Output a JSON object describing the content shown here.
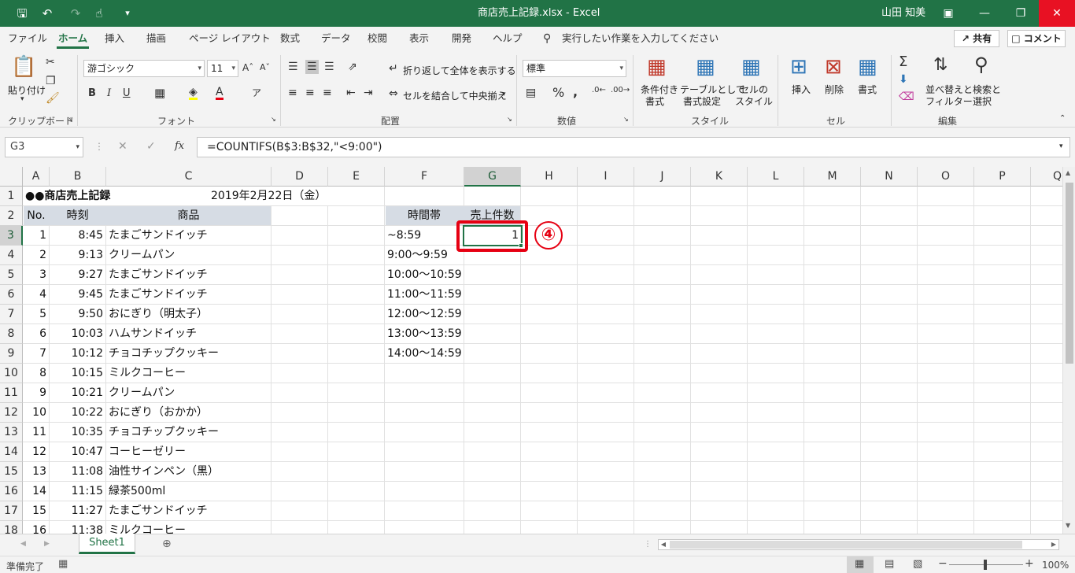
{
  "titlebar": {
    "filename": "商店売上記録.xlsx",
    "separator": " - ",
    "app": "Excel",
    "user": "山田 知美"
  },
  "menu_tabs": [
    "ファイル",
    "ホーム",
    "挿入",
    "描画",
    "ページ レイアウト",
    "数式",
    "データ",
    "校閲",
    "表示",
    "開発",
    "ヘルプ"
  ],
  "search_placeholder": "実行したい作業を入力してください",
  "share_label": "共有",
  "comment_label": "コメント",
  "ribbon": {
    "paste": "貼り付け",
    "clipboard_group": "クリップボード",
    "font_name": "游ゴシック",
    "font_size": "11",
    "font_group": "フォント",
    "wrap_text": "折り返して全体を表示する",
    "merge_center": "セルを結合して中央揃え",
    "alignment_group": "配置",
    "number_format": "標準",
    "number_group": "数値",
    "cond_format_1": "条件付き",
    "cond_format_2": "書式",
    "table_format_1": "テーブルとして",
    "table_format_2": "書式設定",
    "cell_style_1": "セルの",
    "cell_style_2": "スタイル",
    "styles_group": "スタイル",
    "insert": "挿入",
    "delete": "削除",
    "format": "書式",
    "cells_group": "セル",
    "sort_filter_1": "並べ替えと",
    "sort_filter_2": "フィルター",
    "find_select_1": "検索と",
    "find_select_2": "選択",
    "editing_group": "編集"
  },
  "formula_bar": {
    "name_box": "G3",
    "formula": "=COUNTIFS(B$3:B$32,\"<9:00\")"
  },
  "columns": [
    "A",
    "B",
    "C",
    "D",
    "E",
    "F",
    "G",
    "H",
    "I",
    "J",
    "K",
    "L",
    "M",
    "N",
    "O",
    "P",
    "Q"
  ],
  "row_numbers": [
    "1",
    "2",
    "3",
    "4",
    "5",
    "6",
    "7",
    "8",
    "9",
    "10",
    "11",
    "12",
    "13",
    "14",
    "15",
    "16",
    "17",
    "18"
  ],
  "sheet_title": "●●商店売上記録",
  "sheet_date": "2019年2月22日（金）",
  "table_headers": {
    "no": "No.",
    "time": "時刻",
    "item": "商品",
    "period": "時間帯",
    "count": "売上件数"
  },
  "records": [
    {
      "no": "1",
      "time": "8:45",
      "item": "たまごサンドイッチ"
    },
    {
      "no": "2",
      "time": "9:13",
      "item": "クリームパン"
    },
    {
      "no": "3",
      "time": "9:27",
      "item": "たまごサンドイッチ"
    },
    {
      "no": "4",
      "time": "9:45",
      "item": "たまごサンドイッチ"
    },
    {
      "no": "5",
      "time": "9:50",
      "item": "おにぎり（明太子）"
    },
    {
      "no": "6",
      "time": "10:03",
      "item": "ハムサンドイッチ"
    },
    {
      "no": "7",
      "time": "10:12",
      "item": "チョコチップクッキー"
    },
    {
      "no": "8",
      "time": "10:15",
      "item": "ミルクコーヒー"
    },
    {
      "no": "9",
      "time": "10:21",
      "item": "クリームパン"
    },
    {
      "no": "10",
      "time": "10:22",
      "item": "おにぎり（おかか）"
    },
    {
      "no": "11",
      "time": "10:35",
      "item": "チョコチップクッキー"
    },
    {
      "no": "12",
      "time": "10:47",
      "item": "コーヒーゼリー"
    },
    {
      "no": "13",
      "time": "11:08",
      "item": "油性サインペン（黒）"
    },
    {
      "no": "14",
      "time": "11:15",
      "item": "緑茶500ml"
    },
    {
      "no": "15",
      "time": "11:27",
      "item": "たまごサンドイッチ"
    },
    {
      "no": "16",
      "time": "11:38",
      "item": "ミルクコーヒー"
    }
  ],
  "periods": [
    "~8:59",
    "9:00～9:59",
    "10:00～10:59",
    "11:00～11:59",
    "12:00～12:59",
    "13:00～13:59",
    "14:00～14:59"
  ],
  "g3_value": "1",
  "step_badge": "④",
  "sheet_tab": "Sheet1",
  "status": {
    "ready": "準備完了",
    "zoom": "100%"
  },
  "colors": {
    "accent": "#217346",
    "highlight": "#e60012",
    "header_fill": "#d6dce4"
  }
}
